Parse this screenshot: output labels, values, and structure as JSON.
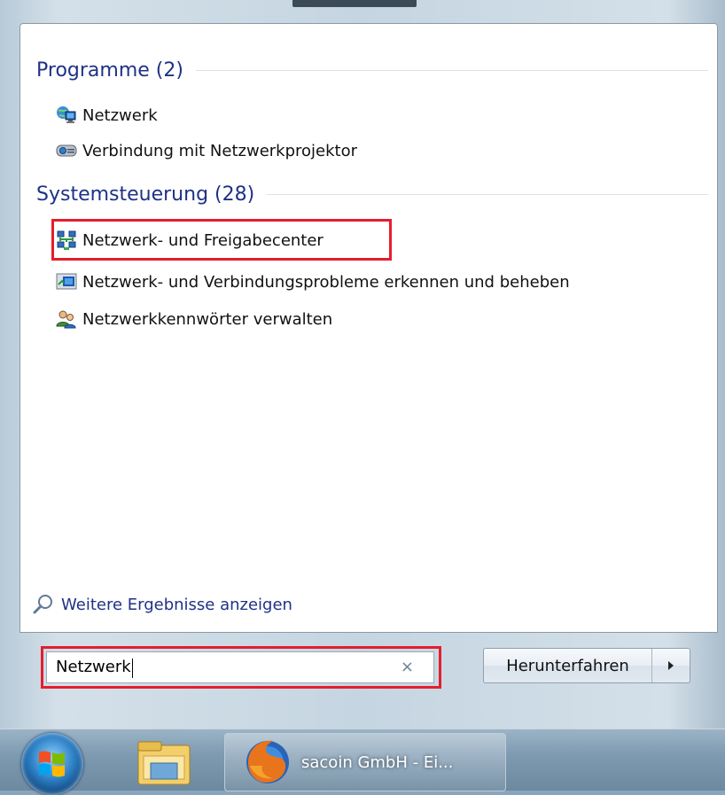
{
  "results": {
    "programs": {
      "header": "Programme (2)",
      "items": [
        {
          "label": "Netzwerk",
          "icon": "network-globe-icon"
        },
        {
          "label": "Verbindung mit Netzwerkprojektor",
          "icon": "projector-icon"
        }
      ]
    },
    "control_panel": {
      "header": "Systemsteuerung (28)",
      "items": [
        {
          "label": "Netzwerk- und Freigabecenter",
          "icon": "network-sharing-center-icon",
          "highlighted": true
        },
        {
          "label": "Netzwerk- und Verbindungsprobleme erkennen und beheben",
          "icon": "troubleshoot-icon"
        },
        {
          "label": "Netzwerkkennwörter verwalten",
          "icon": "credentials-icon"
        }
      ]
    },
    "more_results": {
      "label": "Weitere Ergebnisse anzeigen",
      "icon": "magnifier-icon"
    }
  },
  "search": {
    "value": "Netzwerk",
    "clear_symbol": "×",
    "clear_icon": "clear-x-icon",
    "highlighted": true
  },
  "shutdown": {
    "label": "Herunterfahren",
    "arrow_icon": "triangle-right-icon"
  },
  "taskbar": {
    "start_icon": "windows-orb-icon",
    "pinned": [
      {
        "icon": "windows-explorer-icon"
      }
    ],
    "windows": [
      {
        "label": "sacoin GmbH - Ei...",
        "icon": "firefox-icon"
      }
    ]
  },
  "colors": {
    "highlight": "#e41e2d",
    "section_header": "#1e3287",
    "link": "#1e3287"
  }
}
